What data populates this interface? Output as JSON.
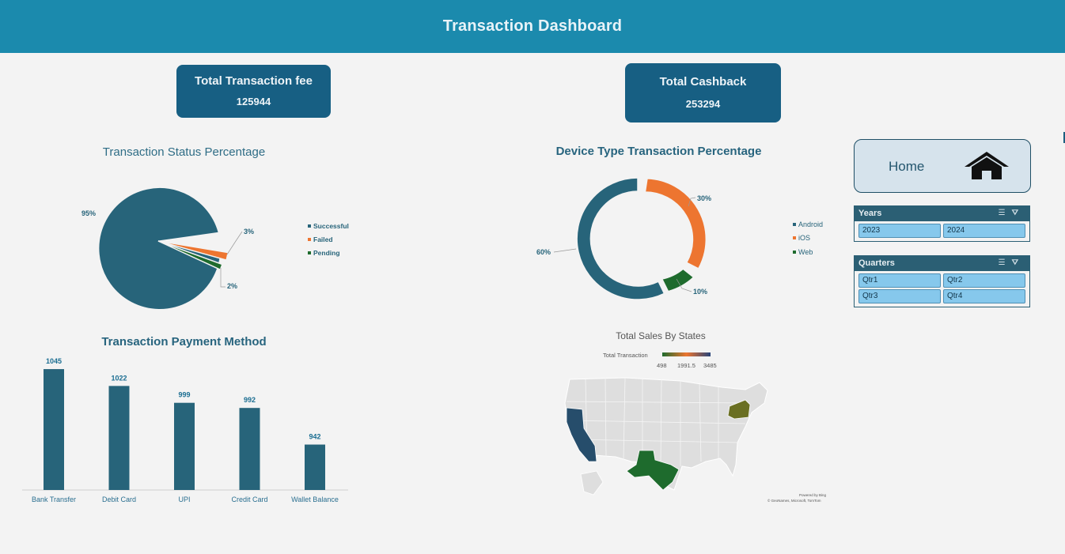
{
  "header": {
    "title": "Transaction Dashboard"
  },
  "kpis": {
    "fee": {
      "title": "Total Transaction fee",
      "value": "125944"
    },
    "cashback": {
      "title": "Total Cashback",
      "value": "253294"
    }
  },
  "status_chart": {
    "title": "Transaction Status Percentage",
    "labels": {
      "successful": "95%",
      "failed": "3%",
      "pending": "2%"
    },
    "legend": [
      "Successful",
      "Failed",
      "Pending"
    ]
  },
  "device_chart": {
    "title": "Device Type Transaction Percentage",
    "labels": {
      "android": "60%",
      "ios": "30%",
      "web": "10%"
    },
    "legend": [
      "Android",
      "iOS",
      "Web"
    ]
  },
  "payment_chart": {
    "title": "Transaction Payment Method",
    "value_labels": [
      "1045",
      "1022",
      "999",
      "992",
      "942"
    ],
    "categories": [
      "Bank Transfer",
      "Debit Card",
      "UPI",
      "Credit Card",
      "Wallet Balance"
    ]
  },
  "map": {
    "title": "Total Sales By States",
    "legend_title": "Total Transaction",
    "legend_min": "498",
    "legend_mid": "1991.5",
    "legend_max": "3485",
    "credit_line1": "Powered by Bing",
    "credit_line2": "© GeoNames, Microsoft, TomTom"
  },
  "home_button": {
    "label": "Home"
  },
  "slicers": {
    "years": {
      "title": "Years",
      "items": [
        "2023",
        "2024"
      ]
    },
    "quarters": {
      "title": "Quarters",
      "items": [
        "Qtr1",
        "Qtr2",
        "Qtr3",
        "Qtr4"
      ]
    }
  },
  "colors": {
    "teal": "#27647a",
    "orange": "#ed7530",
    "green": "#1e6b2d",
    "header": "#1b8aad"
  },
  "chart_data": [
    {
      "type": "pie",
      "title": "Transaction Status Percentage",
      "categories": [
        "Successful",
        "Failed",
        "Pending"
      ],
      "values": [
        95,
        3,
        2
      ]
    },
    {
      "type": "pie",
      "title": "Device Type Transaction Percentage",
      "categories": [
        "Android",
        "iOS",
        "Web"
      ],
      "values": [
        60,
        30,
        10
      ]
    },
    {
      "type": "bar",
      "title": "Transaction Payment Method",
      "categories": [
        "Bank Transfer",
        "Debit Card",
        "UPI",
        "Credit Card",
        "Wallet Balance"
      ],
      "values": [
        1045,
        1022,
        999,
        992,
        942
      ]
    }
  ]
}
